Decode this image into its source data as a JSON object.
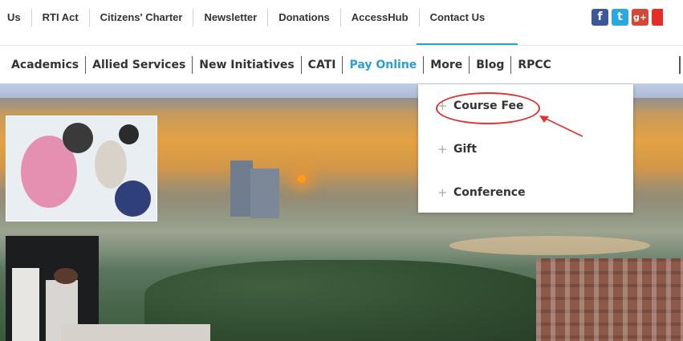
{
  "top_links": [
    {
      "label": "Us"
    },
    {
      "label": "RTI Act"
    },
    {
      "label": "Citizens' Charter"
    },
    {
      "label": "Newsletter"
    },
    {
      "label": "Donations"
    },
    {
      "label": "AccessHub"
    },
    {
      "label": "Contact Us"
    }
  ],
  "social": {
    "facebook": "f",
    "twitter": "t",
    "googleplus": "g+"
  },
  "main_nav": [
    {
      "label": "Academics"
    },
    {
      "label": "Allied Services"
    },
    {
      "label": "New Initiatives"
    },
    {
      "label": "CATI"
    },
    {
      "label": "Pay Online",
      "active": true
    },
    {
      "label": "More"
    },
    {
      "label": "Blog"
    },
    {
      "label": "RPCC"
    }
  ],
  "dropdown": {
    "parent": "Pay Online",
    "items": [
      {
        "label": "Course Fee",
        "highlighted": true
      },
      {
        "label": "Gift"
      },
      {
        "label": "Conference"
      }
    ]
  },
  "colors": {
    "accent": "#2a9fd6",
    "annotation": "#e03232"
  }
}
